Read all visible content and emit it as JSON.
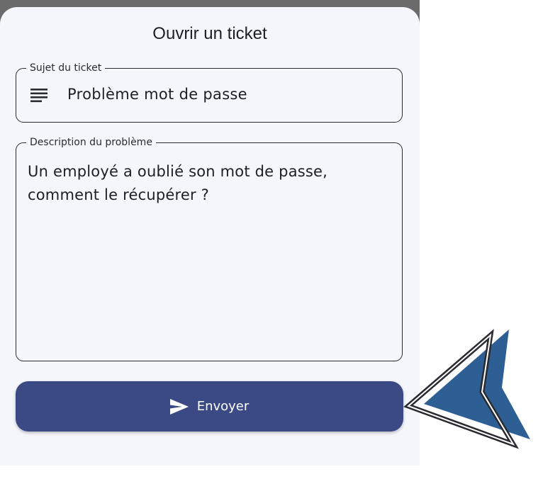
{
  "dialog": {
    "title": "Ouvrir un ticket"
  },
  "subject_field": {
    "label": "Sujet du ticket",
    "value": "Problème mot de passe",
    "icon": "lines-icon"
  },
  "description_field": {
    "label": "Description du problème",
    "value": "Un employé a oublié son mot de passe,\ncomment le récupérer ?"
  },
  "send_button": {
    "label": "Envoyer",
    "icon": "send-icon"
  },
  "annotation": {
    "icon": "pointer-arrow-icon",
    "color": "#2e5f94"
  },
  "colors": {
    "primary": "#3b4a85",
    "sheet_background": "#f5f6fc",
    "border": "#2a2b30"
  }
}
